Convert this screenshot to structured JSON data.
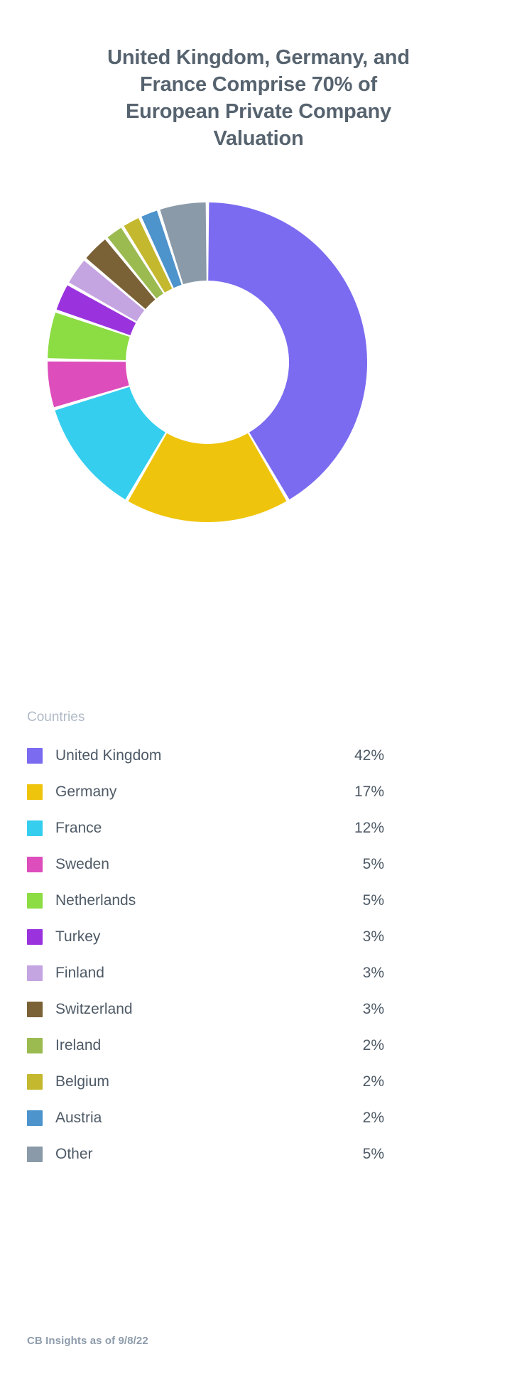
{
  "chart_data": {
    "type": "pie",
    "title": "United Kingdom, Germany, and France Comprise 70% of European Private Company Valuation",
    "subtitle": "",
    "xlabel": "",
    "ylabel": "",
    "legend_position": "bottom",
    "legend_title": "Countries",
    "source": "CB Insights as of 9/8/22",
    "donut": true,
    "inner_radius_ratio": 0.51,
    "start_angle_deg": 0,
    "direction": "clockwise",
    "slice_gap_deg": 1.2,
    "categories": [
      "United Kingdom",
      "Germany",
      "France",
      "Sweden",
      "Netherlands",
      "Turkey",
      "Finland",
      "Switzerland",
      "Ireland",
      "Belgium",
      "Austria",
      "Other"
    ],
    "values": [
      42,
      17,
      12,
      5,
      5,
      3,
      3,
      3,
      2,
      2,
      2,
      5
    ],
    "value_labels": [
      "42%",
      "17%",
      "12%",
      "5%",
      "5%",
      "3%",
      "3%",
      "3%",
      "2%",
      "2%",
      "2%",
      "5%"
    ],
    "colors": [
      "#7b6bf0",
      "#efc40d",
      "#35ceee",
      "#dd4dbc",
      "#8cdc43",
      "#9a33dd",
      "#c5a4e2",
      "#7a6136",
      "#9bbb50",
      "#c4b82e",
      "#4d93cc",
      "#8a9aa8"
    ]
  },
  "title": {
    "text": "United Kingdom, Germany, and\nFrance Comprise 70% of\nEuropean Private Company\nValuation"
  },
  "legend": {
    "heading": "Countries",
    "items": [
      {
        "label": "United Kingdom",
        "value": "42%",
        "color": "#7b6bf0"
      },
      {
        "label": "Germany",
        "value": "17%",
        "color": "#efc40d"
      },
      {
        "label": "France",
        "value": "12%",
        "color": "#35ceee"
      },
      {
        "label": "Sweden",
        "value": "5%",
        "color": "#dd4dbc"
      },
      {
        "label": "Netherlands",
        "value": "5%",
        "color": "#8cdc43"
      },
      {
        "label": "Turkey",
        "value": "3%",
        "color": "#9a33dd"
      },
      {
        "label": "Finland",
        "value": "3%",
        "color": "#c5a4e2"
      },
      {
        "label": "Switzerland",
        "value": "3%",
        "color": "#7a6136"
      },
      {
        "label": "Ireland",
        "value": "2%",
        "color": "#9bbb50"
      },
      {
        "label": "Belgium",
        "value": "2%",
        "color": "#c4b82e"
      },
      {
        "label": "Austria",
        "value": "2%",
        "color": "#4d93cc"
      },
      {
        "label": "Other",
        "value": "5%",
        "color": "#8a9aa8"
      }
    ]
  },
  "footer": {
    "source": "CB Insights as of 9/8/22"
  },
  "theme": {
    "background": "#ffffff",
    "title_color": "#56636f",
    "label_color": "#4e5a66",
    "muted_color": "#b0bac6",
    "source_color": "#8e9cab",
    "slice_divider": "#ffffff"
  }
}
